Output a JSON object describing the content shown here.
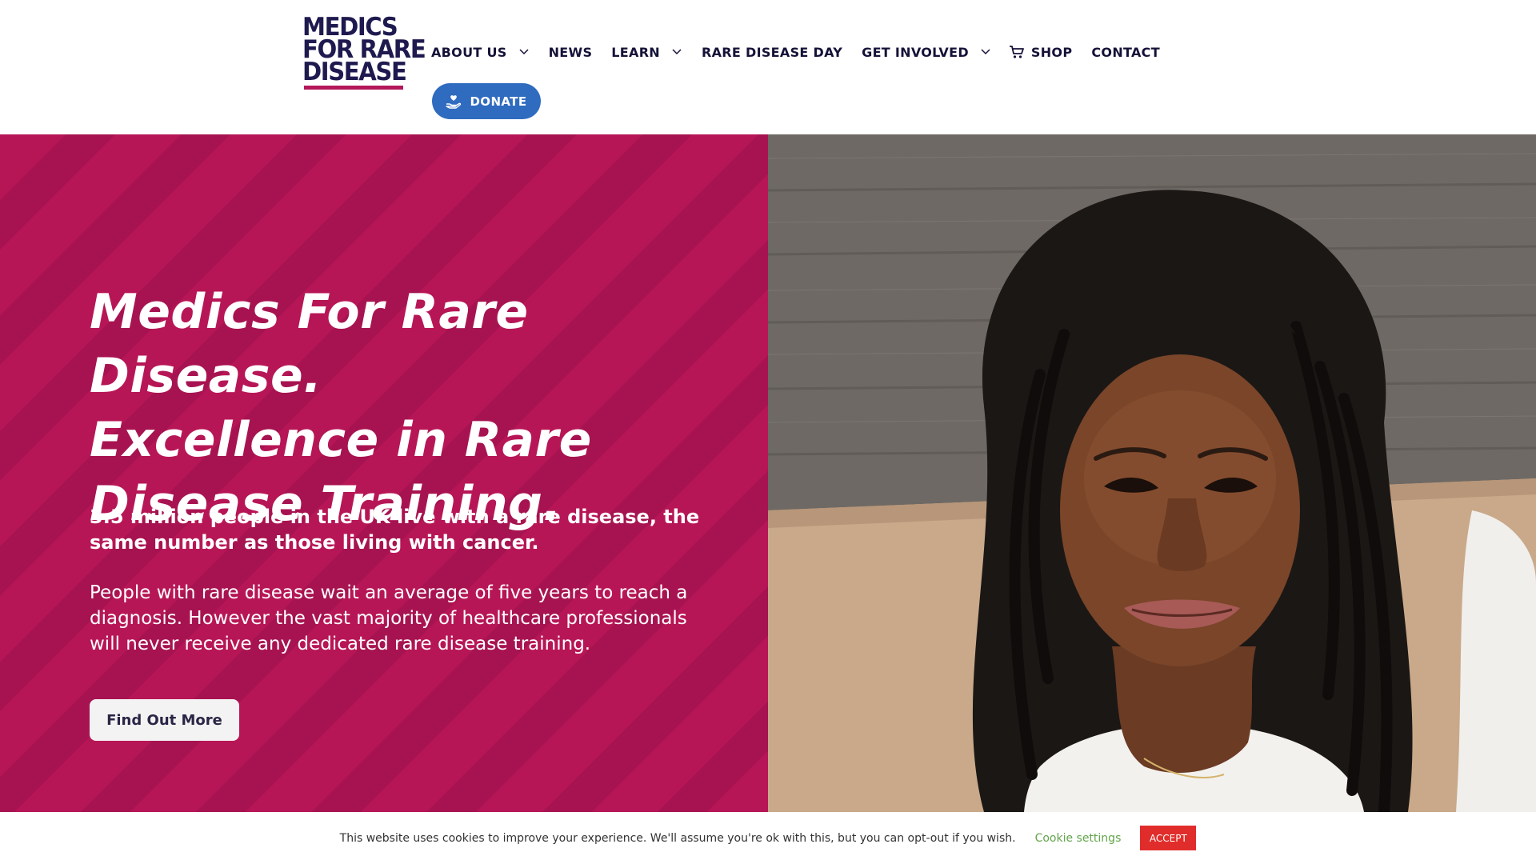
{
  "logo": {
    "line1": "MEDICS",
    "line2": "FOR RARE",
    "line3": "DISEASE"
  },
  "nav": {
    "items": [
      {
        "label": "ABOUT US",
        "has_dropdown": true
      },
      {
        "label": "NEWS",
        "has_dropdown": false
      },
      {
        "label": "LEARN",
        "has_dropdown": true
      },
      {
        "label": "RARE DISEASE DAY",
        "has_dropdown": false
      },
      {
        "label": "GET INVOLVED",
        "has_dropdown": true
      },
      {
        "label": "SHOP",
        "has_dropdown": false,
        "icon": "cart-icon"
      },
      {
        "label": "CONTACT",
        "has_dropdown": false
      }
    ],
    "donate_label": "DONATE",
    "donate_icon": "hand-heart-icon"
  },
  "hero": {
    "title_line1": "Medics For Rare Disease.",
    "title_line2": "Excellence in Rare",
    "title_line3": "Disease Training.",
    "lede": "3.5 million people in the UK live with a rare disease, the same number as those living with cancer.",
    "body": "People with rare disease wait an average of five years to reach a diagnosis. However the vast majority of healthcare professionals will never receive any dedicated rare disease training.",
    "cta_label": "Find Out More"
  },
  "cookie": {
    "text": "This website uses cookies to improve your experience. We'll assume you're ok with this, but you can opt-out if you wish.",
    "settings_label": "Cookie settings",
    "accept_label": "ACCEPT"
  },
  "colors": {
    "brand_navy": "#1e1a4f",
    "brand_magenta": "#b71656",
    "donate_blue": "#2f6bbf",
    "accept_red": "#e02d2b",
    "settings_green": "#62a54c"
  }
}
